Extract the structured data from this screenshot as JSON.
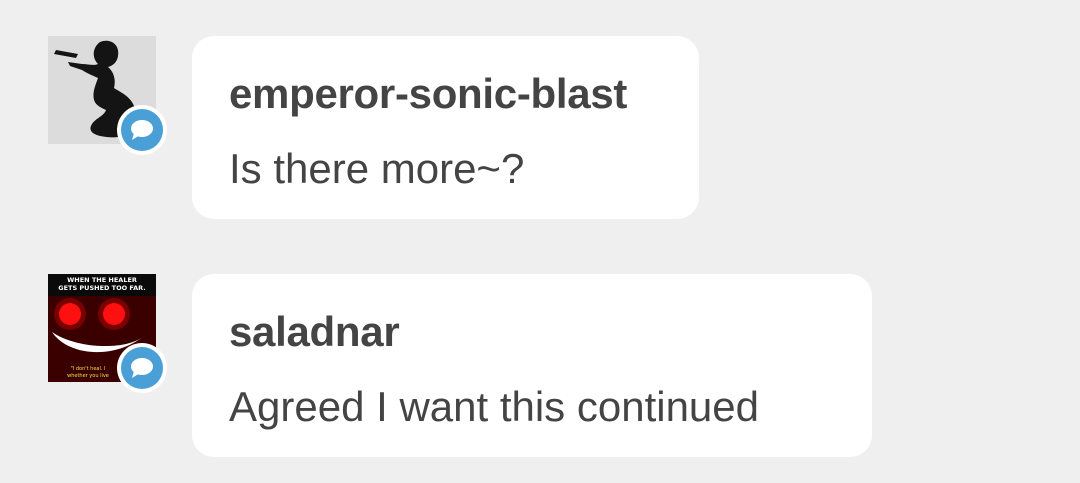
{
  "replies": [
    {
      "username": "emperor-sonic-blast",
      "message": "Is there more~?",
      "avatar_icon": "silhouette-avatar",
      "badge_icon": "speech-bubble-icon"
    },
    {
      "username": "saladnar",
      "message": "Agreed I want this continued",
      "avatar_icon": "red-eyes-meme-avatar",
      "avatar_caption_line1": "WHEN THE HEALER",
      "avatar_caption_line2": "GETS PUSHED TOO FAR.",
      "badge_icon": "speech-bubble-icon"
    }
  ],
  "colors": {
    "background": "#efefef",
    "bubble": "#ffffff",
    "text": "#444444",
    "badge": "#4a9fd6"
  }
}
